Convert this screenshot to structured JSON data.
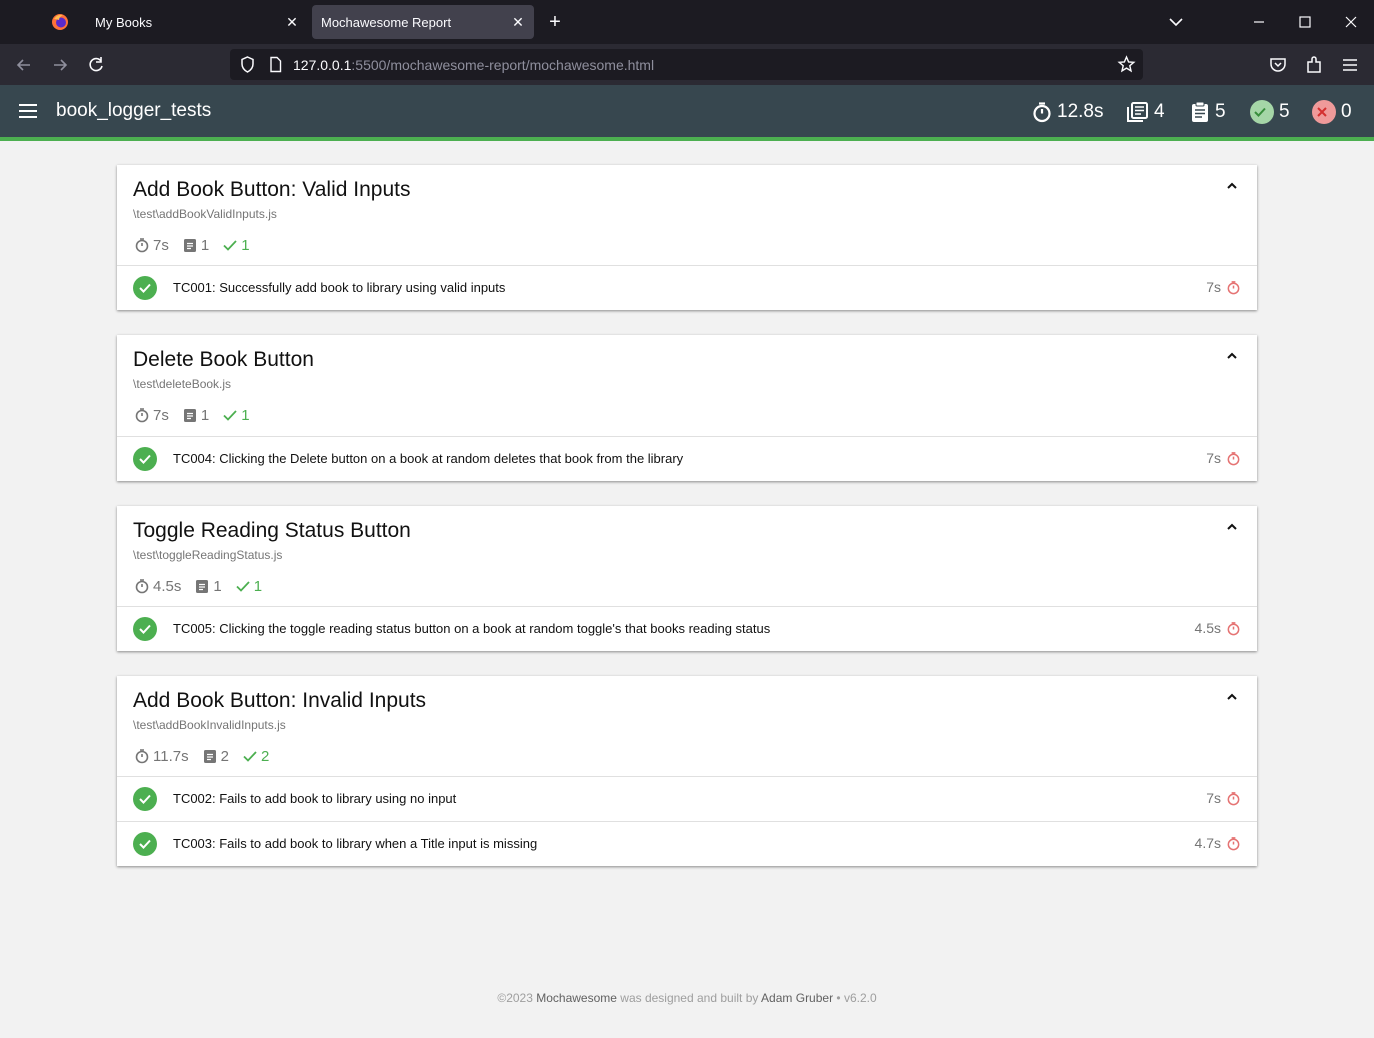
{
  "browser": {
    "tabs": [
      {
        "title": "My Books"
      },
      {
        "title": "Mochawesome Report"
      }
    ],
    "url": {
      "host": "127.0.0.1",
      "rest": ":5500/mochawesome-report/mochawesome.html"
    }
  },
  "report": {
    "title": "book_logger_tests",
    "stats": {
      "duration": "12.8s",
      "suites": "4",
      "tests": "5",
      "passes": "5",
      "failures": "0"
    },
    "colors": {
      "pass": "#4caf50",
      "fail": "#f44336",
      "header": "#37474f"
    }
  },
  "suites": [
    {
      "title": "Add Book Button: Valid Inputs",
      "file": "\\test\\addBookValidInputs.js",
      "duration": "7s",
      "tests": "1",
      "passes": "1",
      "test_list": [
        {
          "title": "TC001: Successfully add book to library using valid inputs",
          "duration": "7s"
        }
      ]
    },
    {
      "title": "Delete Book Button",
      "file": "\\test\\deleteBook.js",
      "duration": "7s",
      "tests": "1",
      "passes": "1",
      "test_list": [
        {
          "title": "TC004: Clicking the Delete button on a book at random deletes that book from the library",
          "duration": "7s"
        }
      ]
    },
    {
      "title": "Toggle Reading Status Button",
      "file": "\\test\\toggleReadingStatus.js",
      "duration": "4.5s",
      "tests": "1",
      "passes": "1",
      "test_list": [
        {
          "title": "TC005: Clicking the toggle reading status button on a book at random toggle's that books reading status",
          "duration": "4.5s"
        }
      ]
    },
    {
      "title": "Add Book Button: Invalid Inputs",
      "file": "\\test\\addBookInvalidInputs.js",
      "duration": "11.7s",
      "tests": "2",
      "passes": "2",
      "test_list": [
        {
          "title": "TC002: Fails to add book to library using no input",
          "duration": "7s"
        },
        {
          "title": "TC003: Fails to add book to library when a Title input is missing",
          "duration": "4.7s"
        }
      ]
    }
  ],
  "footer": {
    "prefix": "©2023 ",
    "brand": "Mochawesome",
    "middle": " was designed and built by ",
    "author": "Adam Gruber",
    "version": " • v6.2.0"
  }
}
